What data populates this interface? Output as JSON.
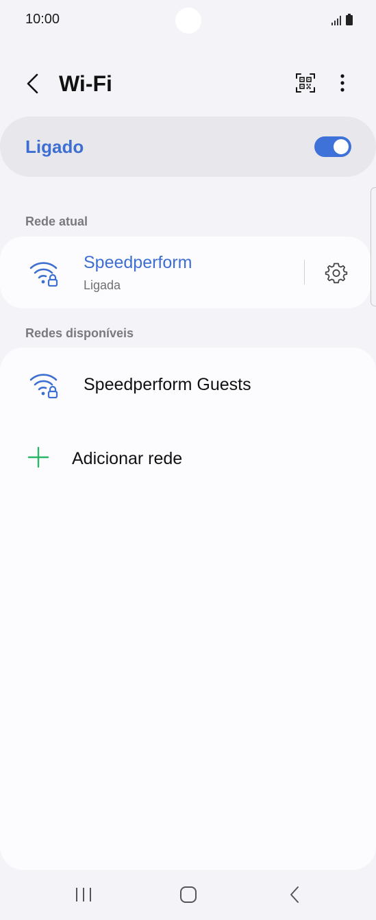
{
  "status_bar": {
    "time": "10:00"
  },
  "header": {
    "title": "Wi-Fi",
    "back_icon": "back-arrow-icon",
    "qr_icon": "qr-code-icon",
    "more_icon": "more-vertical-icon"
  },
  "master_toggle": {
    "label": "Ligado",
    "on": true
  },
  "current_network": {
    "section_title": "Rede atual",
    "name": "Speedperform",
    "status": "Ligada",
    "icon": "wifi-secured-icon",
    "settings_icon": "gear-icon"
  },
  "available_networks": {
    "section_title": "Redes disponíveis",
    "items": [
      {
        "name": "Speedperform Guests",
        "icon": "wifi-secured-icon"
      }
    ],
    "add_network_label": "Adicionar rede"
  },
  "colors": {
    "accent": "#3d6ed1",
    "switch": "#3e72d8",
    "add_icon": "#2bb566",
    "background": "#f4f3f7",
    "card": "#fcfcfe"
  },
  "nav_bar": {
    "recents_icon": "recents-icon",
    "home_icon": "home-icon",
    "back_icon": "nav-back-icon"
  }
}
